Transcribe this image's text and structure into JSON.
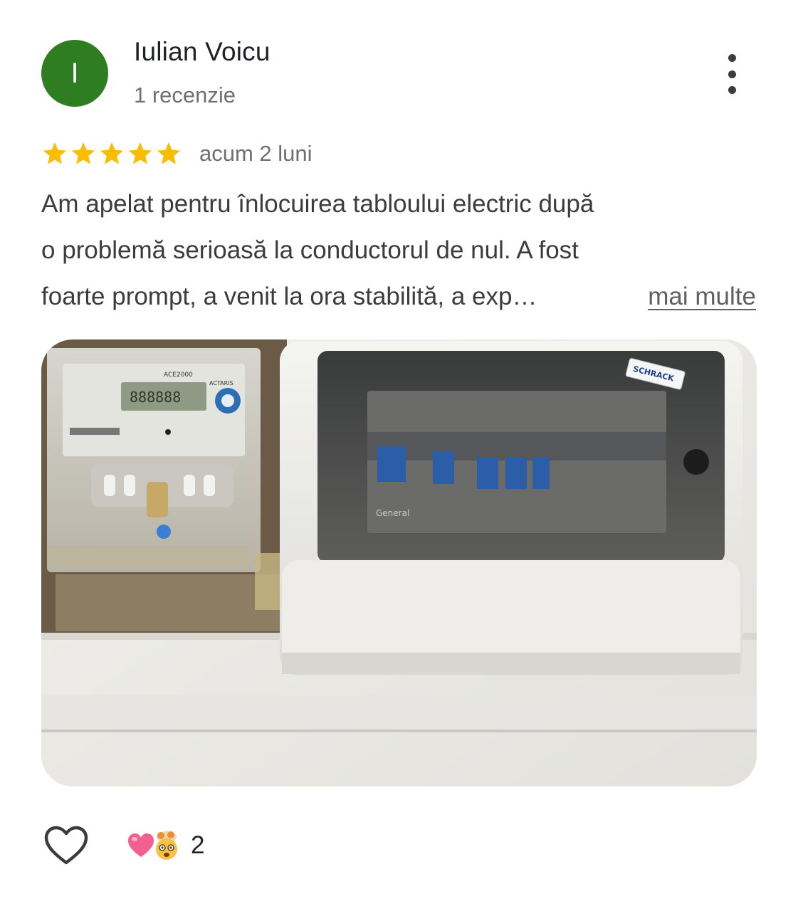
{
  "review": {
    "author": {
      "initial": "I",
      "name": "Iulian Voicu",
      "meta": "1 recenzie",
      "avatar_color": "#2e7d20"
    },
    "rating": 5,
    "rating_max": 5,
    "time": "acum 2 luni",
    "text_lines": [
      "Am apelat pentru înlocuirea tabloului electric după",
      "o problemă serioasă la conductorul de nul. A fost",
      "foarte prompt, a venit la ora stabilită, a exp…"
    ],
    "more_label": "mai multe",
    "photo": {
      "brand_label": "SCHRACK",
      "meter_model": "ACE2000",
      "meter_brand": "ACTARIS",
      "panel_label": "General"
    },
    "actions": {
      "like_icon": "heart-outline-icon",
      "reaction_icons": [
        "pink-heart-emoji-icon",
        "mind-blown-emoji-icon"
      ],
      "reaction_count": "2"
    },
    "colors": {
      "star": "#fbbc04",
      "secondary_text": "#6f6f6f",
      "body_text": "#3c3c3c"
    }
  }
}
